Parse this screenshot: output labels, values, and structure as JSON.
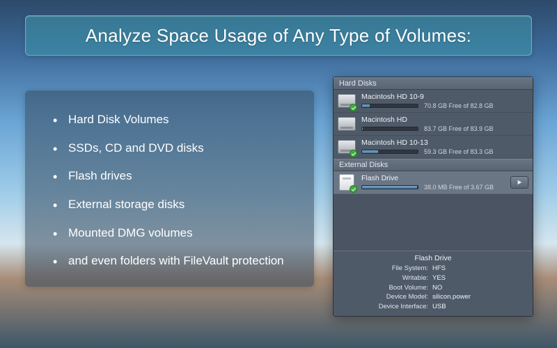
{
  "title": "Analyze Space Usage of Any Type of Volumes:",
  "features": [
    "Hard Disk Volumes",
    "SSDs, CD and DVD disks",
    "Flash drives",
    "External storage disks",
    "Mounted DMG volumes",
    "and even folders with FileVault protection"
  ],
  "panel": {
    "sections": {
      "hard_disks": "Hard Disks",
      "external_disks": "External Disks"
    },
    "hard_disks": [
      {
        "name": "Macintosh HD 10-9",
        "free_text": "70.8 GB Free of 82.8 GB",
        "used_pct": 14,
        "badge": true
      },
      {
        "name": "Macintosh HD",
        "free_text": "83.7 GB Free of 83.9 GB",
        "used_pct": 1,
        "badge": false
      },
      {
        "name": "Macintosh HD 10-13",
        "free_text": "59.3 GB Free of 83.3 GB",
        "used_pct": 29,
        "badge": true
      }
    ],
    "external_disks": [
      {
        "name": "Flash Drive",
        "free_text": "38.0 MB Free of 3.67 GB",
        "used_pct": 99,
        "badge": true,
        "selected": true,
        "play": true
      }
    ],
    "details": {
      "title": "Flash Drive",
      "rows": [
        {
          "label": "File System:",
          "value": "HFS"
        },
        {
          "label": "Writable:",
          "value": "YES"
        },
        {
          "label": "Boot Volume:",
          "value": "NO"
        },
        {
          "label": "Device Model:",
          "value": "silicon.power"
        },
        {
          "label": "Device Interface:",
          "value": "USB"
        }
      ]
    }
  },
  "colors": {
    "accent": "#3c96aa",
    "panel_bg": "#4f5a68"
  }
}
